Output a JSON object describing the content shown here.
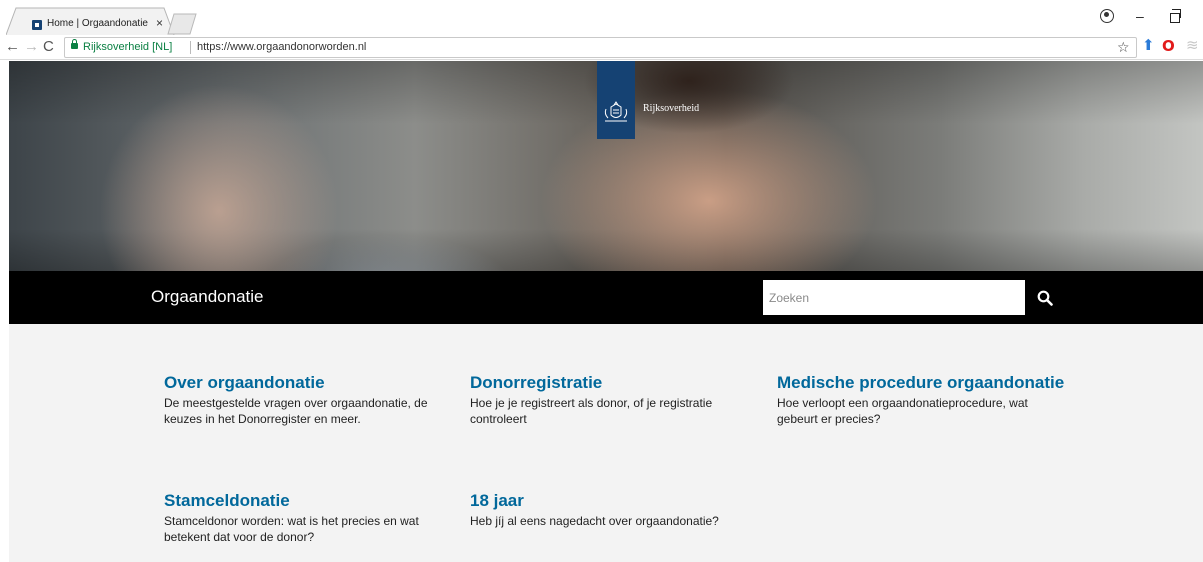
{
  "browser": {
    "tab_title": "Home | Orgaandonatie",
    "tab_close": "×",
    "ev_name": "Rijksoverheid [NL]",
    "url": "https://www.orgaandonorworden.nl",
    "minimize": "–",
    "star": "☆",
    "icons": {
      "back": "back-arrow-icon",
      "forward": "forward-arrow-icon",
      "reload": "reload-icon",
      "lock": "lock-icon",
      "star": "star-icon",
      "profile": "profile-icon",
      "extension_1": "shield-extension-icon",
      "extension_2": "opera-extension-icon",
      "extension_3": "stack-extension-icon"
    }
  },
  "hero": {
    "logo_text": "Rijksoverheid",
    "colors": {
      "banner": "#154273"
    }
  },
  "header": {
    "site_title": "Orgaandonatie",
    "search_placeholder": "Zoeken"
  },
  "topics": [
    {
      "title": "Over orgaandonatie",
      "description": "De meestgestelde vragen over orgaandonatie, de keuzes in het Donorregister en meer."
    },
    {
      "title": "Donorregistratie",
      "description": "Hoe je je registreert als donor, of je registratie controleert"
    },
    {
      "title": "Medische procedure orgaandonatie",
      "description": "Hoe verloopt een orgaandonatieprocedure, wat gebeurt er precies?"
    },
    {
      "title": "Stamceldonatie",
      "description": "Stamceldonor worden: wat is het precies en wat betekent dat voor de donor?"
    },
    {
      "title": "18 jaar",
      "description": "Heb jíj al eens nagedacht over orgaandonatie?"
    }
  ],
  "colors": {
    "link": "#01689b",
    "content_bg": "#f3f3f3",
    "bar_bg": "#000000"
  }
}
